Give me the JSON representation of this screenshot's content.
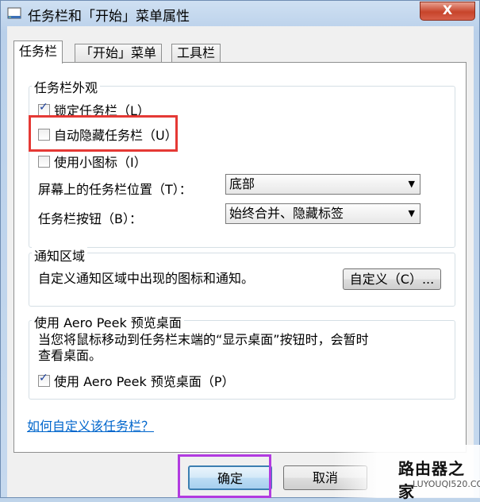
{
  "window": {
    "title": "任务栏和「开始」菜单属性",
    "close_label": "X"
  },
  "tabs": [
    "任务栏",
    "「开始」菜单",
    "工具栏"
  ],
  "appearance": {
    "title": "任务栏外观",
    "lock": {
      "label": "锁定任务栏（L）",
      "checked": true
    },
    "autohide": {
      "label": "自动隐藏任务栏（U）",
      "checked": false
    },
    "small_icons": {
      "label": "使用小图标（I）",
      "checked": false
    },
    "position": {
      "label": "屏幕上的任务栏位置（T）：",
      "value": "底部"
    },
    "buttons": {
      "label": "任务栏按钮（B）：",
      "value": "始终合并、隐藏标签"
    }
  },
  "notification": {
    "title": "通知区域",
    "text": "自定义通知区域中出现的图标和通知。",
    "customize_button": "自定义（C）..."
  },
  "aero_peek": {
    "title": "使用 Aero Peek 预览桌面",
    "description_line1": "当您将鼠标移动到任务栏末端的“显示桌面”按钮时，会暂时",
    "description_line2": "查看桌面。",
    "checkbox": {
      "label": "使用 Aero Peek 预览桌面（P）",
      "checked": true
    }
  },
  "help_link": "如何自定义该任务栏？",
  "footer": {
    "ok": "确定",
    "cancel": "取消"
  },
  "watermark": {
    "logo": "路由器之家",
    "url": "LUYOUQI520.COM"
  },
  "colors": {
    "highlight_red": "#e53935",
    "highlight_purple": "#b23be0",
    "link": "#0066cc"
  }
}
